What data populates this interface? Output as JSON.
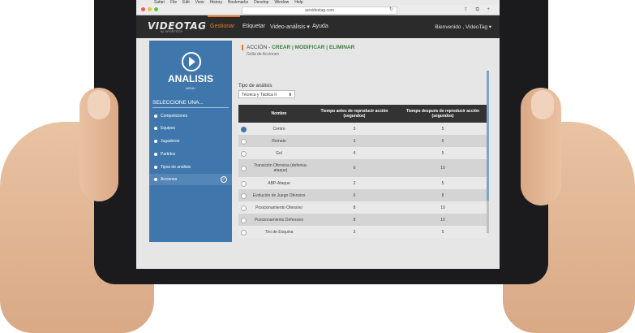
{
  "browser": {
    "menu": [
      "Safari",
      "File",
      "Edit",
      "View",
      "History",
      "Bookmarks",
      "Develop",
      "Window",
      "Help"
    ],
    "url": "acividestag.com"
  },
  "app": {
    "logo": "VIDEOTAG",
    "logo_sub": "by SPORTECH",
    "nav": [
      "Gestionar",
      "Etiquetar",
      "Video-análisis ▾",
      "Ayuda"
    ],
    "user": "Bienvenido , VideoTag ▾",
    "accent": "#e6782c"
  },
  "sidebar": {
    "title": "ANALISIS",
    "subtitle": "MENU",
    "select_label": "SELECCIONE UNA...",
    "items": [
      {
        "label": "Competiciones"
      },
      {
        "label": "Equipos"
      },
      {
        "label": "Jugadores"
      },
      {
        "label": "Partidos"
      },
      {
        "label": "Tipos de análisis"
      },
      {
        "label": "Acciones"
      }
    ],
    "color": "#3f77ad"
  },
  "main": {
    "crumb_prefix": "ACCIÓN - ",
    "crumb_actions": "CREAR | MODIFICAR | ELIMINAR",
    "subcrumb": "Grilla de Acciones",
    "tipo_label": "Tipo de análisis",
    "tipo_value": "Técnica y Táctica II"
  },
  "table": {
    "headers": [
      "Nombre",
      "Tiempo antes de reproducir acción (segundos)",
      "Tiempo después de reproducir acción (segundos)"
    ],
    "rows": [
      {
        "name": "Centro",
        "before": "3",
        "after": "5"
      },
      {
        "name": "Remate",
        "before": "3",
        "after": "5"
      },
      {
        "name": "Gol",
        "before": "4",
        "after": "5"
      },
      {
        "name": "Transición Ofensiva (defensa-ataque)",
        "before": "6",
        "after": "10"
      },
      {
        "name": "ABP-Ataque",
        "before": "2",
        "after": "5"
      },
      {
        "name": "Evolución de Juego Ofensivo",
        "before": "6",
        "after": "8"
      },
      {
        "name": "Posicionamiento Ofensivo",
        "before": "8",
        "after": "10"
      },
      {
        "name": "Posicionamiento Defensivo",
        "before": "8",
        "after": "10"
      },
      {
        "name": "Tiro de Esquina",
        "before": "3",
        "after": "5"
      }
    ]
  }
}
